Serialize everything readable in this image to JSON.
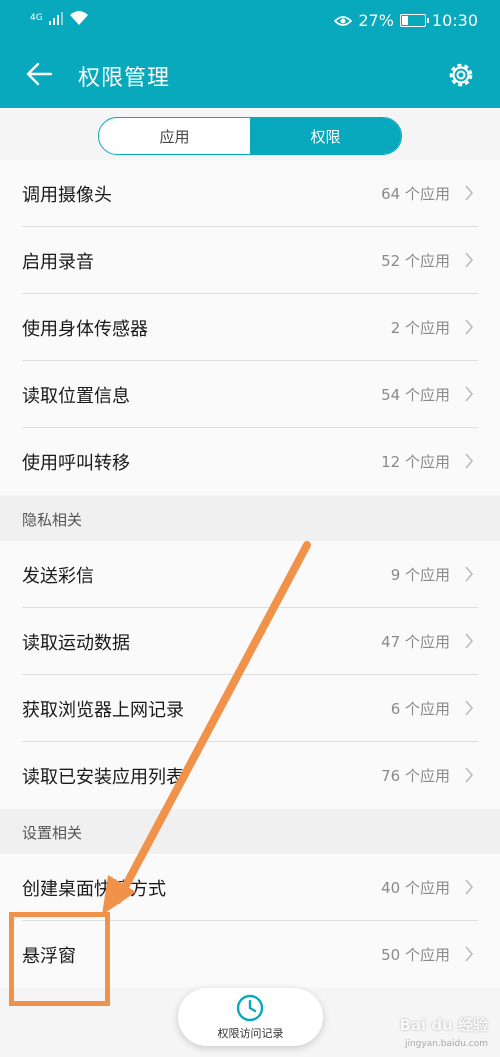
{
  "status": {
    "signal": "4G",
    "battery": "27%",
    "battery_level": 0.27,
    "time": "10:30"
  },
  "appbar": {
    "title": "权限管理"
  },
  "tabs": {
    "apps_label": "应用",
    "permissions_label": "权限",
    "selected": "权限"
  },
  "permissions": [
    {
      "label": "调用摄像头",
      "count": "64 个应用"
    },
    {
      "label": "启用录音",
      "count": "52 个应用"
    },
    {
      "label": "使用身体传感器",
      "count": "2 个应用"
    },
    {
      "label": "读取位置信息",
      "count": "54 个应用"
    },
    {
      "label": "使用呼叫转移",
      "count": "12 个应用"
    }
  ],
  "privacy": {
    "header": "隐私相关",
    "items": [
      {
        "label": "发送彩信",
        "count": "9 个应用"
      },
      {
        "label": "读取运动数据",
        "count": "47 个应用"
      },
      {
        "label": "获取浏览器上网记录",
        "count": "6 个应用"
      },
      {
        "label": "读取已安装应用列表",
        "count": "76 个应用"
      }
    ]
  },
  "settings": {
    "header": "设置相关",
    "items": [
      {
        "label": "创建桌面快捷方式",
        "count": "40 个应用"
      },
      {
        "label": "悬浮窗",
        "count": "50 个应用"
      }
    ]
  },
  "fab": {
    "label": "权限访问记录"
  },
  "watermark": {
    "text": "Bai du 经验",
    "sub": "jingyan.baidu.com"
  },
  "colors": {
    "accent": "#09a9bd",
    "annotation": "#f0924a"
  }
}
